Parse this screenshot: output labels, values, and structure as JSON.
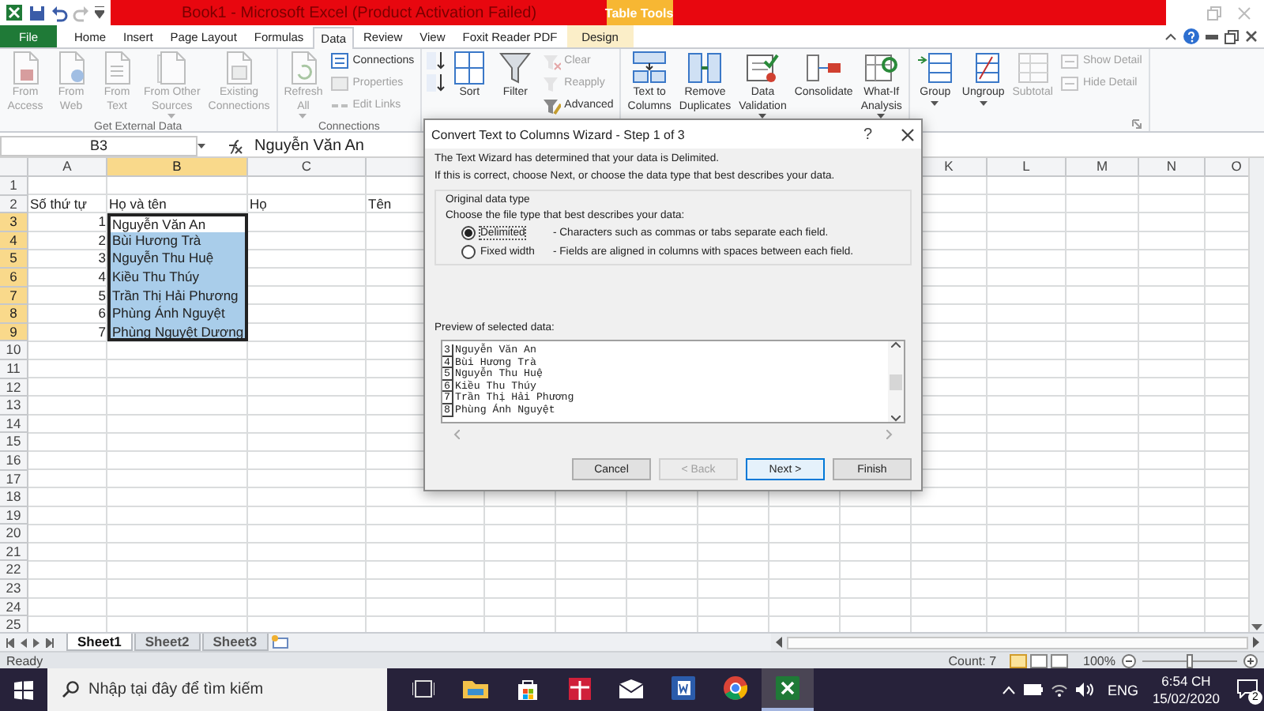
{
  "window": {
    "title": "Book1 - Microsoft Excel (Product Activation Failed)",
    "context_tab": "Table Tools"
  },
  "ribbon_tabs": [
    {
      "label": "File",
      "kind": "file",
      "selected": false
    },
    {
      "label": "Home",
      "kind": "tab",
      "selected": false
    },
    {
      "label": "Insert",
      "kind": "tab",
      "selected": false
    },
    {
      "label": "Page Layout",
      "kind": "tab",
      "selected": false
    },
    {
      "label": "Formulas",
      "kind": "tab",
      "selected": false
    },
    {
      "label": "Data",
      "kind": "tab",
      "selected": true
    },
    {
      "label": "Review",
      "kind": "tab",
      "selected": false
    },
    {
      "label": "View",
      "kind": "tab",
      "selected": false
    },
    {
      "label": "Foxit Reader PDF",
      "kind": "tab",
      "selected": false
    },
    {
      "label": "Design",
      "kind": "context",
      "selected": false
    }
  ],
  "ribbon_groups": [
    {
      "title": "Get External Data",
      "items": [
        {
          "label": "From\nAccess",
          "kind": "large",
          "disabled": true,
          "dropdown": false
        },
        {
          "label": "From\nWeb",
          "kind": "large",
          "disabled": true,
          "dropdown": false
        },
        {
          "label": "From\nText",
          "kind": "large",
          "disabled": true,
          "dropdown": false
        },
        {
          "label": "From Other\nSources",
          "kind": "large",
          "disabled": true,
          "dropdown": true
        },
        {
          "label": "Existing\nConnections",
          "kind": "large",
          "disabled": true,
          "dropdown": false
        }
      ]
    },
    {
      "title": "Connections",
      "items": [
        {
          "label": "Refresh\nAll",
          "kind": "large",
          "disabled": true,
          "dropdown": true
        },
        {
          "label": "Connections",
          "kind": "small",
          "disabled": false,
          "dropdown": false
        },
        {
          "label": "Properties",
          "kind": "small",
          "disabled": true,
          "dropdown": false
        },
        {
          "label": "Edit Links",
          "kind": "small",
          "disabled": true,
          "dropdown": false
        }
      ]
    },
    {
      "items": [
        {
          "kind": "icon",
          "disabled": false,
          "dropdown": false
        },
        {
          "kind": "icon",
          "disabled": false,
          "dropdown": false
        },
        {
          "label": "Sort",
          "kind": "large",
          "disabled": false,
          "dropdown": false
        },
        {
          "label": "Filter",
          "kind": "large",
          "disabled": false,
          "dropdown": false
        },
        {
          "label": "Clear",
          "kind": "small",
          "disabled": true,
          "dropdown": false
        },
        {
          "label": "Reapply",
          "kind": "small",
          "disabled": true,
          "dropdown": false
        },
        {
          "label": "Advanced",
          "kind": "small",
          "disabled": false,
          "dropdown": false
        }
      ]
    },
    {
      "items": [
        {
          "label": "Text to\nColumns",
          "kind": "large",
          "disabled": false,
          "dropdown": false
        },
        {
          "label": "Remove\nDuplicates",
          "kind": "large",
          "disabled": false,
          "dropdown": false
        },
        {
          "label": "Data\nValidation",
          "kind": "large",
          "disabled": false,
          "dropdown": true
        },
        {
          "label": "Consolidate",
          "kind": "large",
          "disabled": false,
          "dropdown": false
        },
        {
          "label": "What-If\nAnalysis",
          "kind": "large",
          "disabled": false,
          "dropdown": true
        }
      ]
    },
    {
      "items": [
        {
          "label": "Group",
          "kind": "large",
          "disabled": false,
          "dropdown": true
        },
        {
          "label": "Ungroup",
          "kind": "large",
          "disabled": false,
          "dropdown": true
        },
        {
          "label": "Subtotal",
          "kind": "large",
          "disabled": true,
          "dropdown": false
        },
        {
          "label": "Show Detail",
          "kind": "small",
          "disabled": true,
          "dropdown": false
        },
        {
          "label": "Hide Detail",
          "kind": "small",
          "disabled": true,
          "dropdown": false
        }
      ]
    }
  ],
  "formula_bar": {
    "name_box": "B3",
    "value": "Nguyễn Văn An"
  },
  "columns": [
    {
      "letter": "A",
      "selected": false
    },
    {
      "letter": "B",
      "selected": true
    },
    {
      "letter": "C",
      "selected": false
    },
    {
      "letter": "K",
      "selected": false
    },
    {
      "letter": "L",
      "selected": false
    },
    {
      "letter": "M",
      "selected": false
    },
    {
      "letter": "N",
      "selected": false
    },
    {
      "letter": "O",
      "selected": false
    }
  ],
  "rows": [
    {
      "number": "1",
      "selected": false
    },
    {
      "number": "2",
      "selected": false,
      "cells": [
        {
          "text": "Số thứ tự",
          "kind": "text",
          "active": false,
          "selected": false
        },
        {
          "text": "Họ và tên",
          "kind": "text",
          "active": false,
          "selected": false
        },
        {
          "text": "Họ",
          "kind": "text",
          "active": false,
          "selected": false
        },
        {
          "text": "Tên",
          "kind": "text",
          "active": false,
          "selected": false
        }
      ]
    },
    {
      "number": "3",
      "selected": true,
      "cells": [
        {
          "text": "1",
          "kind": "number",
          "active": false,
          "selected": false
        },
        {
          "text": "Nguyễn Văn An",
          "kind": "text",
          "active": true,
          "selected": false
        }
      ]
    },
    {
      "number": "4",
      "selected": true,
      "cells": [
        {
          "text": "2",
          "kind": "number",
          "active": false,
          "selected": false
        },
        {
          "text": "Bùi Hương Trà",
          "kind": "text",
          "active": false,
          "selected": true
        }
      ]
    },
    {
      "number": "5",
      "selected": true,
      "cells": [
        {
          "text": "3",
          "kind": "number",
          "active": false,
          "selected": false
        },
        {
          "text": "Nguyễn Thu Huệ",
          "kind": "text",
          "active": false,
          "selected": true
        }
      ]
    },
    {
      "number": "6",
      "selected": true,
      "cells": [
        {
          "text": "4",
          "kind": "number",
          "active": false,
          "selected": false
        },
        {
          "text": "Kiều Thu Thúy",
          "kind": "text",
          "active": false,
          "selected": true
        }
      ]
    },
    {
      "number": "7",
      "selected": true,
      "cells": [
        {
          "text": "5",
          "kind": "number",
          "active": false,
          "selected": false
        },
        {
          "text": "Trần Thị Hải Phương",
          "kind": "text",
          "active": false,
          "selected": true
        }
      ]
    },
    {
      "number": "8",
      "selected": true,
      "cells": [
        {
          "text": "6",
          "kind": "number",
          "active": false,
          "selected": false
        },
        {
          "text": "Phùng Ánh Nguyệt",
          "kind": "text",
          "active": false,
          "selected": true
        }
      ]
    },
    {
      "number": "9",
      "selected": true,
      "cells": [
        {
          "text": "7",
          "kind": "number",
          "active": false,
          "selected": false
        },
        {
          "text": "Phùng Nguyệt Dương",
          "kind": "text",
          "active": false,
          "selected": true
        }
      ]
    },
    {
      "number": "10",
      "selected": false
    },
    {
      "number": "11",
      "selected": false
    },
    {
      "number": "12",
      "selected": false
    },
    {
      "number": "13",
      "selected": false
    },
    {
      "number": "14",
      "selected": false
    },
    {
      "number": "15",
      "selected": false
    },
    {
      "number": "16",
      "selected": false
    },
    {
      "number": "17",
      "selected": false
    },
    {
      "number": "18",
      "selected": false
    },
    {
      "number": "19",
      "selected": false
    },
    {
      "number": "20",
      "selected": false
    },
    {
      "number": "21",
      "selected": false
    },
    {
      "number": "22",
      "selected": false
    },
    {
      "number": "23",
      "selected": false
    },
    {
      "number": "24",
      "selected": false
    },
    {
      "number": "25",
      "selected": false
    }
  ],
  "sheet_tabs": [
    {
      "label": "Sheet1",
      "selected": true
    },
    {
      "label": "Sheet2",
      "selected": false
    },
    {
      "label": "Sheet3",
      "selected": false
    }
  ],
  "status_bar": {
    "status": "Ready",
    "count": "Count: 7",
    "zoom": "100%",
    "zoom_level": {
      "level": 0.5
    },
    "views": [
      {
        "selected": true
      },
      {
        "selected": false
      },
      {
        "selected": false
      }
    ]
  },
  "dialog": {
    "title": "Convert Text to Columns Wizard - Step 1 of 3",
    "help": "?",
    "lines": [
      "The Text Wizard has determined that your data is Delimited.",
      "If this is correct, choose Next, or choose the data type that best describes your data."
    ],
    "group_title": "Original data type",
    "prompt": "Choose the file type that best describes your data:",
    "options": [
      {
        "label": "Delimited",
        "description": "- Characters such as commas or tabs separate each field.",
        "selected": true
      },
      {
        "label": "Fixed width",
        "description": "- Fields are aligned in columns with spaces between each field.",
        "selected": false
      }
    ],
    "preview_label": "Preview of selected data:",
    "preview": [
      {
        "number": "3",
        "text": "Nguyễn Văn An"
      },
      {
        "number": "4",
        "text": "Bùi Hương Trà"
      },
      {
        "number": "5",
        "text": "Nguyễn Thu Huệ"
      },
      {
        "number": "6",
        "text": "Kiều Thu Thúy"
      },
      {
        "number": "7",
        "text": "Trần Thị Hải Phương"
      },
      {
        "number": "8",
        "text": "Phùng Ánh Nguyệt"
      }
    ],
    "buttons": [
      {
        "label": "Cancel",
        "disabled": false,
        "default": false
      },
      {
        "label": "< Back",
        "disabled": true,
        "default": false
      },
      {
        "label": "Next >",
        "disabled": false,
        "default": true
      },
      {
        "label": "Finish",
        "disabled": false,
        "default": false
      }
    ]
  },
  "taskbar": {
    "search": {
      "placeholder": "Nhập tại đây để tìm kiếm"
    },
    "apps": [
      {
        "selected": false
      },
      {
        "selected": false
      },
      {
        "selected": false
      },
      {
        "selected": false
      },
      {
        "selected": false
      },
      {
        "selected": false
      },
      {
        "selected": false
      },
      {
        "selected": true
      }
    ],
    "language": "ENG",
    "time": "6:54 CH",
    "date": "15/02/2020",
    "notifications": "2"
  }
}
